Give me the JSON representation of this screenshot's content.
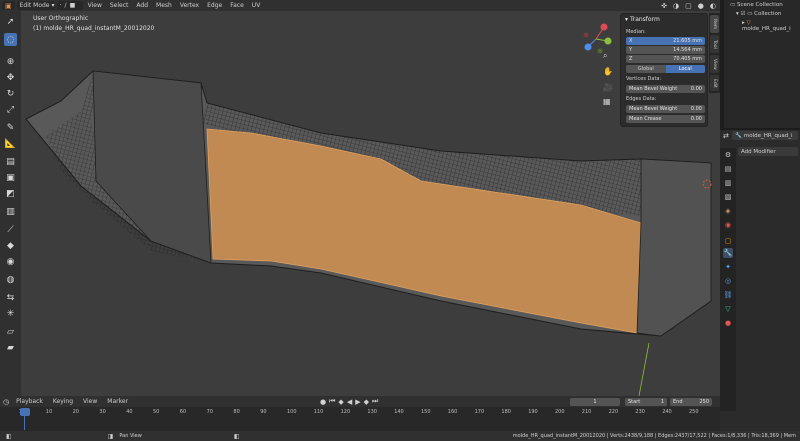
{
  "header": {
    "mode": "Edit Mode",
    "menus": [
      "View",
      "Select",
      "Add",
      "Mesh",
      "Vertex",
      "Edge",
      "Face",
      "UV"
    ]
  },
  "viewport": {
    "view_name": "User Orthographic",
    "object_label": "(1) molde_HR_quad_instantM_20012020"
  },
  "transform_panel": {
    "title": "Transform",
    "median_label": "Median:",
    "x_label": "X",
    "x_value": "21.605 mm",
    "y_label": "Y",
    "y_value": "14.564 mm",
    "z_label": "Z",
    "z_value": "70.405 mm",
    "global_label": "Global",
    "local_label": "Local",
    "vertices_data_label": "Vertices Data:",
    "vert_bevel_label": "Mean Bevel Weight",
    "vert_bevel_value": "0.00",
    "edges_data_label": "Edges Data:",
    "edge_bevel_label": "Mean Bevel Weight",
    "edge_bevel_value": "0.00",
    "crease_label": "Mean Crease",
    "crease_value": "0.00"
  },
  "side_tabs": [
    "Item",
    "Tool",
    "View",
    "Edit"
  ],
  "outliner": {
    "scene_collection": "Scene Collection",
    "collection": "Collection",
    "object": "molde_HR_quad_i"
  },
  "properties": {
    "object_name": "molde_HR_quad_i",
    "add_modifier": "Add Modifier"
  },
  "timeline": {
    "menus": [
      "Playback",
      "Keying",
      "View",
      "Marker"
    ],
    "current_frame": "1",
    "start_label": "Start",
    "start_value": "1",
    "end_label": "End",
    "end_value": "250",
    "ticks": [
      "1",
      "10",
      "20",
      "30",
      "40",
      "50",
      "60",
      "70",
      "80",
      "90",
      "100",
      "110",
      "120",
      "130",
      "140",
      "150",
      "160",
      "170",
      "180",
      "190",
      "200",
      "210",
      "220",
      "230",
      "240",
      "250"
    ]
  },
  "statusbar": {
    "left_hint": "Pan View",
    "stats": "molde_HR_quad_instantM_20012020 | Verts:2438/9,188 | Edges:2437/17,522 | Faces:1/8,336 | Tris:18,369 | Mem"
  },
  "colors": {
    "viewport_bg": "#3d3d3d",
    "mesh_gray": "#595959",
    "selected_face": "#c08a52",
    "accent_blue": "#4772b3"
  }
}
